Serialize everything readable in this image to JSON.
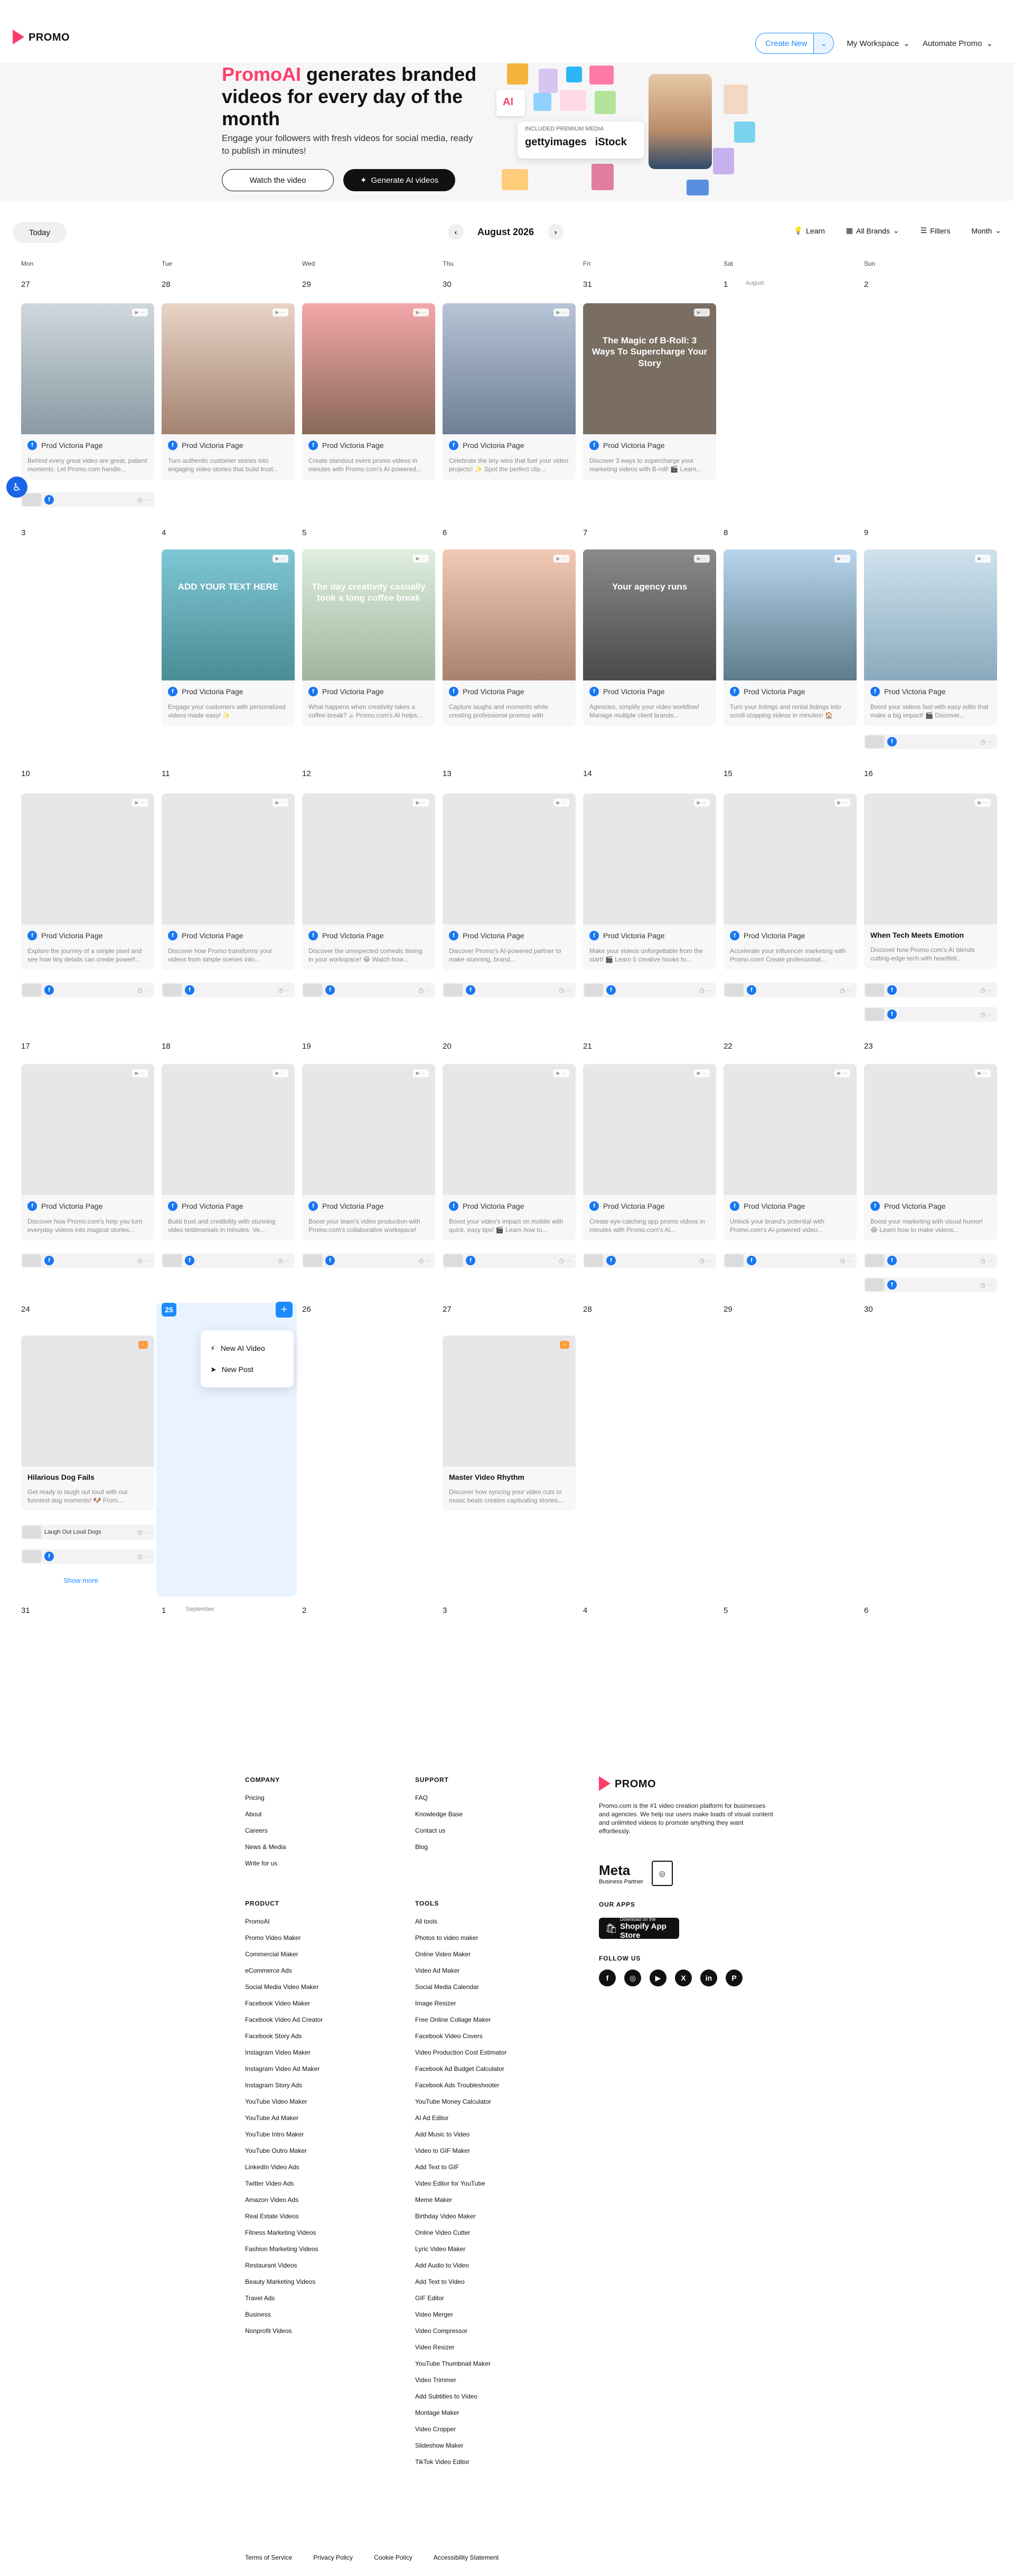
{
  "header": {
    "logo_text": "PROMO",
    "create_label": "Create New",
    "workspace_label": "My Workspace",
    "automate_label": "Automate Promo"
  },
  "hero": {
    "title_brand": "PromoAI",
    "title_rest": " generates branded videos for every day of the month",
    "subtitle": "Engage your followers with fresh videos for social media, ready to publish in minutes!",
    "watch_label": "Watch the video",
    "generate_label": "Generate AI videos",
    "ai_label": "AI",
    "partners_caption": "INCLUDED PREMIUM MEDIA",
    "partner_1": "gettyimages",
    "partner_2": "iStock"
  },
  "toolbar": {
    "today_label": "Today",
    "month_label": "August 2026",
    "learn_label": "Learn",
    "brands_label": "All Brands",
    "filters_label": "Filters",
    "view_label": "Month"
  },
  "calendar": {
    "weekdays": [
      "Mon",
      "Tue",
      "Wed",
      "Thu",
      "Fri",
      "Sat",
      "Sun"
    ],
    "month_tag_aug": "August",
    "month_tag_sep": "September",
    "page_name": "Prod Victoria Page",
    "show_more": "Show more",
    "weeks": [
      [
        "27",
        "28",
        "29",
        "30",
        "31",
        "1",
        "2"
      ],
      [
        "3",
        "4",
        "5",
        "6",
        "7",
        "8",
        "9"
      ],
      [
        "10",
        "11",
        "12",
        "13",
        "14",
        "15",
        "16"
      ],
      [
        "17",
        "18",
        "19",
        "20",
        "21",
        "22",
        "23"
      ],
      [
        "24",
        "25",
        "26",
        "27",
        "28",
        "29",
        "30"
      ],
      [
        "31",
        "1",
        "2",
        "3",
        "4",
        "5",
        "6"
      ]
    ],
    "w1": [
      {
        "desc": "Behind every great video are great, patient moments. Let Promo.com handle...",
        "overlay": ""
      },
      {
        "desc": "Turn authentic customer stories into engaging video stories that build trust...",
        "overlay": ""
      },
      {
        "desc": "Create standout event promo videos in minutes with Promo.com's AI-powered...",
        "overlay": ""
      },
      {
        "desc": "Celebrate the tiny wins that fuel your video projects! ✨ Spot the perfect clip...",
        "overlay": ""
      },
      {
        "desc": "Discover 3 ways to supercharge your marketing videos with B-roll! 🎬 Learn...",
        "overlay": "The Magic of B-Roll: 3 Ways To Supercharge Your Story"
      }
    ],
    "w2": [
      {
        "desc": "Engage your customers with personalized videos made easy! ✨",
        "overlay": "ADD YOUR TEXT HERE"
      },
      {
        "desc": "What happens when creativity takes a coffee break? ☕ Promo.com's AI helps...",
        "overlay": "The day creativity casually took a long coffee break"
      },
      {
        "desc": "Capture laughs and moments while creating professional promos with Promo.com...",
        "overlay": ""
      },
      {
        "desc": "Agencies, simplify your video workflow! Manage multiple client brands...",
        "overlay": "Your agency runs"
      },
      {
        "desc": "Turn your listings and rental listings into scroll-stopping videos in minutes! 🏠",
        "overlay": ""
      },
      {
        "desc": "Boost your videos fast with easy edits that make a big impact! 🎬 Discover...",
        "overlay": ""
      }
    ],
    "w3": [
      {
        "desc": "Explore the journey of a simple pixel and see how tiny details can create powerf..."
      },
      {
        "desc": "Discover how Promo transforms your videos from simple scenes into..."
      },
      {
        "desc": "Discover the unexpected comedic timing in your workspace! 😂 Watch how..."
      },
      {
        "desc": "Discover Promo's AI-powered partner to make stunning, brand..."
      },
      {
        "desc": "Make your videos unforgettable from the start! 🎬 Learn 5 creative hooks to..."
      },
      {
        "desc": "Accelerate your influencer marketing with Promo.com! Create professional..."
      },
      {
        "desc": "Discover how Promo.com's AI blends cutting-edge tech with heartfelt...",
        "title": "When Tech Meets Emotion"
      }
    ],
    "w4": [
      {
        "desc": "Discover how Promo.com's help you turn everyday videos into magical stories..."
      },
      {
        "desc": "Build trust and credibility with stunning video testimonials in minutes. Ve..."
      },
      {
        "desc": "Boost your team's video production with Promo.com's collaborative workspace!"
      },
      {
        "desc": "Boost your video's impact on mobile with quick, easy tips! 🎬 Learn how to..."
      },
      {
        "desc": "Create eye-catching app promo videos in minutes with Promo.com's AI..."
      },
      {
        "desc": "Unlock your brand's potential with Promo.com's AI-powered video..."
      },
      {
        "desc": "Boost your marketing with visual humor! 😂 Learn how to make videos..."
      }
    ],
    "hilarious": {
      "title": "Hilarious Dog Fails",
      "desc": "Get ready to laugh out loud with our funniest dog moments! 🐶 From...",
      "sub": "Laugh Out Loud Dogs"
    },
    "master": {
      "title": "Master Video Rhythm",
      "desc": "Discover how syncing your video cuts to music beats creates captivating stories..."
    },
    "menu_ai": "New AI Video",
    "menu_post": "New Post"
  },
  "footer": {
    "company_h": "COMPANY",
    "company": [
      "Pricing",
      "About",
      "Careers",
      "News & Media",
      "Write for us"
    ],
    "support_h": "SUPPORT",
    "support": [
      "FAQ",
      "Knowledge Base",
      "Contact us",
      "Blog"
    ],
    "product_h": "PRODUCT",
    "product": [
      "PromoAI",
      "Promo Video Maker",
      "Commercial Maker",
      "eCommerce Ads",
      "Social Media Video Maker",
      "Facebook Video Maker",
      "Facebook Video Ad Creator",
      "Facebook Story Ads",
      "Instagram Video Maker",
      "Instagram Video Ad Maker",
      "Instagram Story Ads",
      "YouTube Video Maker",
      "YouTube Ad Maker",
      "YouTube Intro Maker",
      "YouTube Outro Maker",
      "LinkedIn Video Ads",
      "Twitter Video Ads",
      "Amazon Video Ads",
      "Real Estate Videos",
      "Fitness Marketing Videos",
      "Fashion Marketing Videos",
      "Restaurant Videos",
      "Beauty Marketing Videos",
      "Travel Ads",
      "Business",
      "Nonprofit Videos"
    ],
    "tools_h": "TOOLS",
    "tools": [
      "All tools",
      "Photos to video maker",
      "Online Video Maker",
      "Video Ad Maker",
      "Social Media Calendar",
      "Image Resizer",
      "Free Online Collage Maker",
      "Facebook Video Covers",
      "Video Production Cost Estimator",
      "Facebook Ad Budget Calculator",
      "Facebook Ads Troubleshooter",
      "YouTube Money Calculator",
      "AI Ad Editor",
      "Add Music to Video",
      "Video to GIF Maker",
      "Add Text to GIF",
      "Video Editor for YouTube",
      "Meme Maker",
      "Birthday Video Maker",
      "Online Video Cutter",
      "Lyric Video Maker",
      "Add Audio to Video",
      "Add Text to Video",
      "GIF Editor",
      "Video Merger",
      "Video Compressor",
      "Video Resizer",
      "YouTube Thumbnail Maker",
      "Video Trimmer",
      "Add Subtitles to Video",
      "Montage Maker",
      "Video Cropper",
      "Slideshow Maker",
      "TikTok Video Editor"
    ],
    "brand_desc": "Promo.com is the #1 video creation platform for businesses and agencies. We help our users make loads of visual content and unlimited videos to promote anything they want effortlessly.",
    "meta_label": "Meta",
    "meta_sub": "Business Partner",
    "apps_h": "OUR APPS",
    "appstore_small": "Download on the",
    "appstore_big": "Shopify App Store",
    "follow_h": "FOLLOW US",
    "legal": [
      "Terms of Service",
      "Privacy Policy",
      "Cookie Policy",
      "Accessibility Statement"
    ]
  }
}
